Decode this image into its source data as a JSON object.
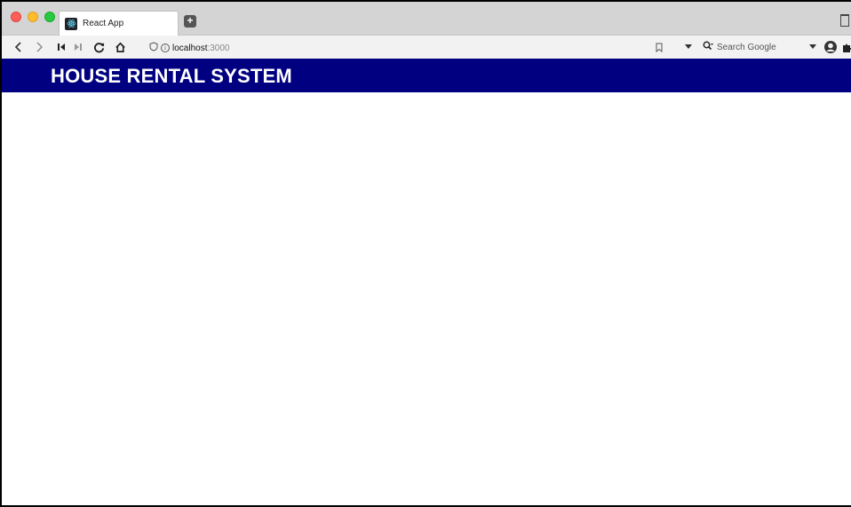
{
  "browser": {
    "tab": {
      "title": "React App"
    },
    "address": {
      "host": "localhost",
      "port": ":3000"
    },
    "search": {
      "placeholder": "Search Google"
    }
  },
  "page": {
    "header_title": "HOUSE RENTAL SYSTEM",
    "header_color": "#000080"
  },
  "icons": {
    "favicon": "react-icon",
    "new_tab": "plus-icon",
    "trash": "trash-icon",
    "back": "chevron-left-icon",
    "forward": "chevron-right-icon",
    "first": "skip-back-icon",
    "last": "skip-forward-icon",
    "reload": "reload-icon",
    "home": "home-icon",
    "shield": "shield-icon",
    "info": "info-icon",
    "bookmark": "bookmark-icon",
    "search": "search-icon",
    "account": "account-icon",
    "extensions": "puzzle-icon"
  }
}
